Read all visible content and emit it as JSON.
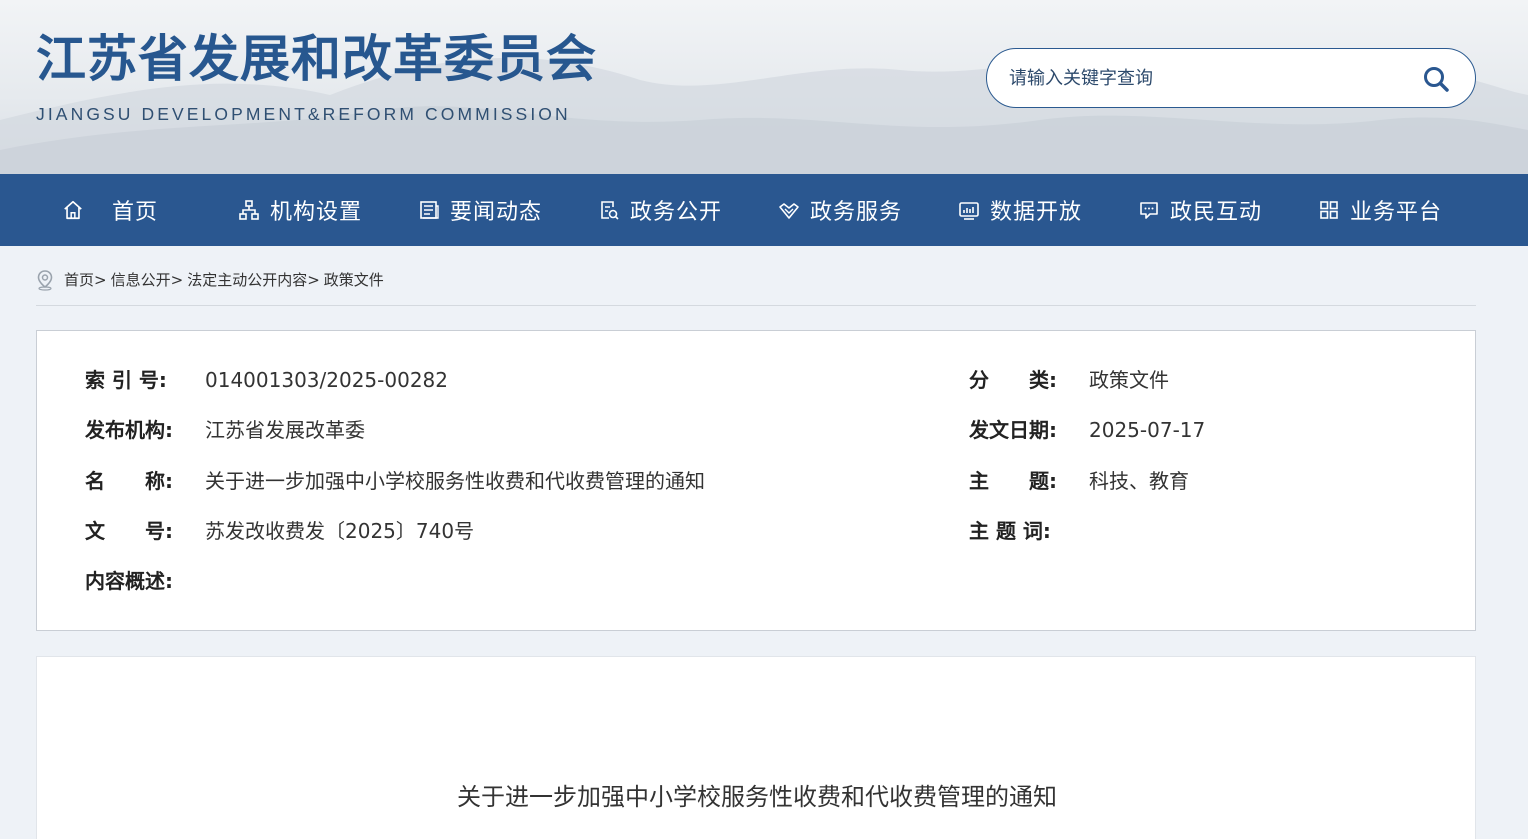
{
  "header": {
    "title": "江苏省发展和改革委员会",
    "subtitle": "JIANGSU DEVELOPMENT&REFORM COMMISSION",
    "search_placeholder": "请输入关键字查询"
  },
  "nav": {
    "items": [
      {
        "label": "首页",
        "icon": "home-icon"
      },
      {
        "label": "机构设置",
        "icon": "org-chart-icon"
      },
      {
        "label": "要闻动态",
        "icon": "newspaper-icon"
      },
      {
        "label": "政务公开",
        "icon": "document-search-icon"
      },
      {
        "label": "政务服务",
        "icon": "handshake-icon"
      },
      {
        "label": "数据开放",
        "icon": "data-monitor-icon"
      },
      {
        "label": "政民互动",
        "icon": "chat-bubble-icon"
      },
      {
        "label": "业务平台",
        "icon": "grid-icon"
      }
    ]
  },
  "breadcrumb": {
    "items": [
      "首页",
      "信息公开",
      "法定主动公开内容",
      "政策文件"
    ],
    "separator": ">"
  },
  "meta": {
    "index_label": "索 引 号:",
    "index_value": "014001303/2025-00282",
    "category_label": "分　　类:",
    "category_value": "政策文件",
    "publisher_label": "发布机构:",
    "publisher_value": "江苏省发展改革委",
    "date_label": "发文日期:",
    "date_value": "2025-07-17",
    "name_label": "名　　称:",
    "name_value": "关于进一步加强中小学校服务性收费和代收费管理的通知",
    "topic_label": "主　　题:",
    "topic_value": "科技、教育",
    "docno_label": "文　　号:",
    "docno_value": "苏发改收费发〔2025〕740号",
    "keywords_label": "主 题 词:",
    "keywords_value": "",
    "summary_label": "内容概述:",
    "summary_value": ""
  },
  "content": {
    "title": "关于进一步加强中小学校服务性收费和代收费管理的通知"
  },
  "colors": {
    "brand_blue": "#2a5790",
    "title_blue": "#27578f",
    "page_bg": "#eef2f7"
  }
}
